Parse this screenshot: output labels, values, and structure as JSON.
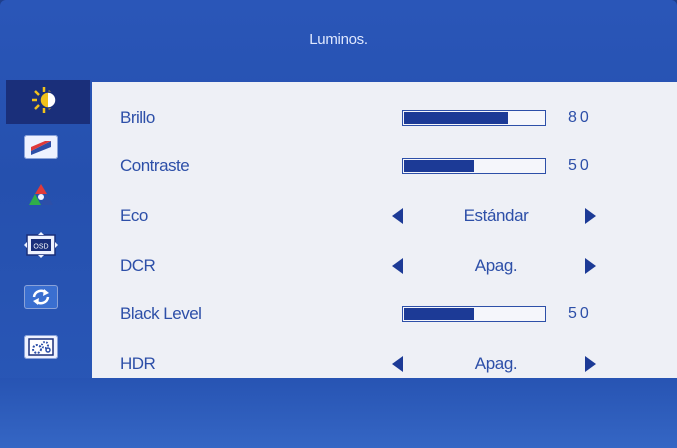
{
  "header": {
    "title": "Luminos."
  },
  "sidebar": {
    "tabs": [
      {
        "icon": "brightness-icon",
        "active": true
      },
      {
        "icon": "image-icon",
        "active": false
      },
      {
        "icon": "color-icon",
        "active": false
      },
      {
        "icon": "osd-icon",
        "active": false
      },
      {
        "icon": "reset-icon",
        "active": false
      },
      {
        "icon": "settings-icon",
        "active": false
      }
    ],
    "osd_icon_text": "OSD"
  },
  "menu": {
    "brillo": {
      "label": "Brillo",
      "value": 80,
      "display": "80"
    },
    "contraste": {
      "label": "Contraste",
      "value": 50,
      "display": "50"
    },
    "eco": {
      "label": "Eco",
      "selected": "Estándar"
    },
    "dcr": {
      "label": "DCR",
      "selected": "Apag."
    },
    "black_level": {
      "label": "Black Level",
      "value": 50,
      "display": "50"
    },
    "hdr": {
      "label": "HDR",
      "selected": "Apag."
    }
  },
  "colors": {
    "frame_blue": "#2a56b8",
    "panel_bg": "#eef0f6",
    "text_blue": "#2d4fa8",
    "bar_fill": "#1c3a96",
    "active_tab": "#1a2f7a"
  }
}
